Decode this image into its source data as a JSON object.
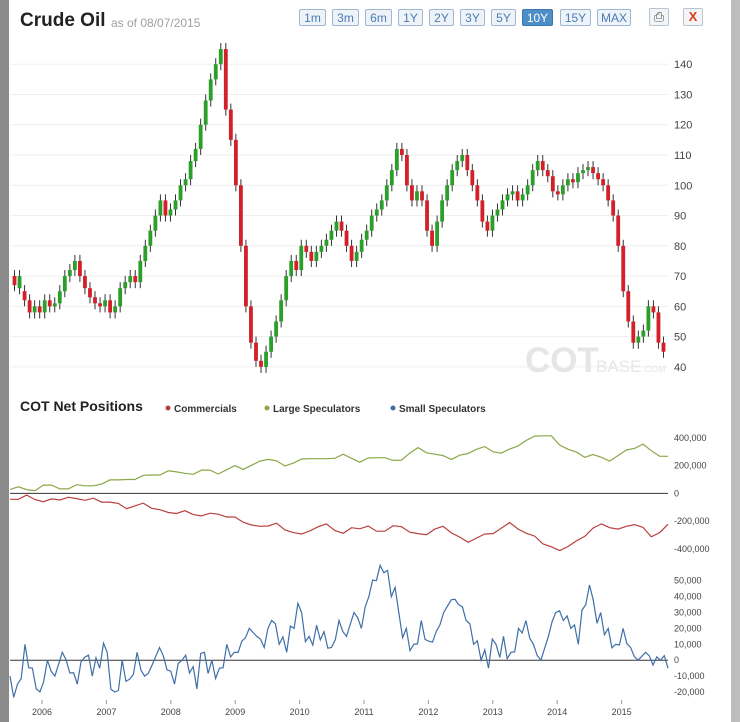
{
  "header": {
    "title": "Crude Oil",
    "as_of": "as of 08/07/2015",
    "ranges": [
      "1m",
      "3m",
      "6m",
      "1Y",
      "2Y",
      "3Y",
      "5Y",
      "10Y",
      "15Y",
      "MAX"
    ],
    "active_range": "10Y",
    "print_icon": "printer-icon",
    "close_label": "X",
    "close_color": "#e0381b"
  },
  "watermark": {
    "big": "COT",
    "small": "BASE",
    "suffix": ".COM"
  },
  "chart_data": [
    {
      "type": "candlestick",
      "title": "Crude Oil",
      "x_ticks": [
        "2006",
        "2007",
        "2008",
        "2009",
        "2010",
        "2011",
        "2012",
        "2013",
        "2014",
        "2015"
      ],
      "ylim": [
        35,
        148
      ],
      "y_ticks": [
        40,
        50,
        60,
        70,
        80,
        90,
        100,
        110,
        120,
        130,
        140
      ],
      "up_color": "#2aa02a",
      "down_color": "#d3202a",
      "x_start": 2005.65,
      "x_step": 0.0833,
      "close": [
        67,
        70,
        62,
        58,
        60,
        58,
        62,
        60,
        61,
        65,
        70,
        72,
        75,
        70,
        66,
        63,
        61,
        60,
        62,
        58,
        60,
        66,
        68,
        70,
        68,
        75,
        80,
        85,
        90,
        95,
        90,
        92,
        95,
        100,
        102,
        108,
        112,
        120,
        128,
        135,
        140,
        145,
        125,
        115,
        100,
        80,
        60,
        48,
        42,
        40,
        45,
        50,
        55,
        62,
        70,
        75,
        72,
        80,
        78,
        75,
        78,
        80,
        82,
        85,
        88,
        85,
        80,
        75,
        78,
        82,
        85,
        90,
        92,
        95,
        100,
        105,
        112,
        110,
        100,
        95,
        98,
        95,
        85,
        80,
        88,
        95,
        100,
        105,
        108,
        110,
        105,
        100,
        95,
        88,
        85,
        90,
        92,
        95,
        97,
        98,
        95,
        97,
        100,
        105,
        108,
        105,
        103,
        98,
        97,
        100,
        102,
        101,
        104,
        105,
        106,
        104,
        102,
        100,
        95,
        90,
        80,
        65,
        55,
        48,
        50,
        52,
        60,
        58,
        48,
        45
      ],
      "open_offset": [
        -3,
        4,
        -3,
        -4,
        2,
        -2,
        4,
        -2,
        1,
        4,
        5,
        2,
        3,
        -5,
        -4,
        -3,
        -2,
        -1,
        2,
        -4,
        2,
        6,
        2,
        2,
        -2,
        7,
        5,
        5,
        5,
        5,
        -5,
        2,
        3,
        5,
        2,
        6,
        4,
        8,
        8,
        7,
        5,
        5,
        -20,
        -10,
        -15,
        -20,
        -20,
        -12,
        -6,
        -2,
        5,
        5,
        5,
        7,
        8,
        5,
        -3,
        8,
        -2,
        -3,
        3,
        2,
        2,
        3,
        3,
        -3,
        -5,
        -5,
        3,
        4,
        3,
        5,
        2,
        3,
        5,
        5,
        7,
        -2,
        -10,
        -5,
        3,
        -3,
        -10,
        -5,
        8,
        7,
        5,
        5,
        3,
        2,
        -5,
        -5,
        -5,
        -7,
        -3,
        5,
        2,
        3,
        2,
        1,
        -3,
        2,
        3,
        5,
        3,
        -3,
        -2,
        -5,
        -1,
        3,
        2,
        -1,
        3,
        1,
        1,
        -2,
        -2,
        -2,
        -5,
        -5,
        -10,
        -15,
        -10,
        -7,
        2,
        2,
        8,
        -2,
        -10,
        -3
      ]
    },
    {
      "type": "line",
      "title": "COT Net Positions",
      "x_ticks": [
        "2006",
        "2007",
        "2008",
        "2009",
        "2010",
        "2011",
        "2012",
        "2013",
        "2014",
        "2015"
      ],
      "ylim": [
        -480000,
        500000
      ],
      "y_ticks": [
        400000,
        200000,
        0,
        -200000,
        -400000
      ],
      "y_tick_labels": [
        "400,000",
        "200,000",
        "0",
        "-200,000",
        "-400,000"
      ],
      "series": [
        {
          "name": "Commercials",
          "color": "#b94040",
          "values": [
            -30000,
            -40000,
            -20000,
            -35000,
            -60000,
            -50000,
            -40000,
            -30000,
            -50000,
            -45000,
            -40000,
            -50000,
            -60000,
            -80000,
            -100000,
            -90000,
            -80000,
            -100000,
            -120000,
            -150000,
            -140000,
            -130000,
            -140000,
            -160000,
            -150000,
            -140000,
            -170000,
            -180000,
            -200000,
            -230000,
            -250000,
            -230000,
            -220000,
            -250000,
            -280000,
            -300000,
            -260000,
            -240000,
            -230000,
            -260000,
            -290000,
            -260000,
            -250000,
            -240000,
            -260000,
            -270000,
            -240000,
            -230000,
            -280000,
            -300000,
            -290000,
            -260000,
            -250000,
            -280000,
            -320000,
            -340000,
            -320000,
            -300000,
            -280000,
            -250000,
            -220000,
            -250000,
            -290000,
            -320000,
            -360000,
            -390000,
            -400000,
            -380000,
            -350000,
            -300000,
            -250000,
            -230000,
            -240000,
            -260000,
            -250000,
            -220000,
            -250000,
            -300000,
            -280000,
            -230000
          ]
        },
        {
          "name": "Large Speculators",
          "color": "#8aa84a",
          "values": [
            40000,
            50000,
            20000,
            30000,
            60000,
            50000,
            40000,
            30000,
            50000,
            60000,
            50000,
            80000,
            100000,
            90000,
            110000,
            100000,
            120000,
            140000,
            130000,
            150000,
            160000,
            140000,
            150000,
            170000,
            160000,
            150000,
            170000,
            190000,
            180000,
            200000,
            220000,
            250000,
            230000,
            210000,
            220000,
            240000,
            260000,
            250000,
            240000,
            260000,
            280000,
            240000,
            230000,
            250000,
            270000,
            260000,
            230000,
            250000,
            290000,
            320000,
            300000,
            280000,
            260000,
            250000,
            270000,
            300000,
            320000,
            330000,
            310000,
            290000,
            310000,
            350000,
            380000,
            400000,
            420000,
            410000,
            360000,
            320000,
            290000,
            270000,
            280000,
            250000,
            240000,
            270000,
            300000,
            330000,
            350000,
            320000,
            270000,
            260000
          ]
        }
      ]
    },
    {
      "type": "line",
      "title": "",
      "x_ticks": [
        "2006",
        "2007",
        "2008",
        "2009",
        "2010",
        "2011",
        "2012",
        "2013",
        "2014",
        "2015"
      ],
      "ylim": [
        -25000,
        58000
      ],
      "y_ticks": [
        50000,
        40000,
        30000,
        20000,
        10000,
        0,
        -10000,
        -20000
      ],
      "y_tick_labels": [
        "50,000",
        "40,000",
        "30,000",
        "20,000",
        "10,000",
        "0",
        "-10,000",
        "-20,000"
      ],
      "series": [
        {
          "name": "Small Speculators",
          "color": "#3f6fa8",
          "values": [
            -10000,
            -15000,
            10000,
            -5000,
            -20000,
            0,
            -10000,
            5000,
            -8000,
            -15000,
            2000,
            -10000,
            -5000,
            5000,
            -20000,
            0,
            -12000,
            5000,
            -10000,
            -3000,
            8000,
            -6000,
            -15000,
            0,
            -8000,
            -18000,
            5000,
            0,
            -5000,
            10000,
            5000,
            12000,
            20000,
            15000,
            8000,
            25000,
            10000,
            5000,
            20000,
            30000,
            15000,
            22000,
            18000,
            8000,
            25000,
            15000,
            30000,
            20000,
            40000,
            50000,
            55000,
            40000,
            30000,
            20000,
            10000,
            25000,
            12000,
            18000,
            30000,
            38000,
            35000,
            25000,
            10000,
            0,
            -5000,
            10000,
            15000,
            5000,
            20000,
            25000,
            10000,
            0,
            15000,
            30000,
            25000,
            20000,
            10000,
            35000,
            38000,
            30000,
            20000,
            10000,
            20000,
            8000,
            0,
            5000,
            -3000,
            0,
            -5000
          ]
        }
      ]
    }
  ]
}
